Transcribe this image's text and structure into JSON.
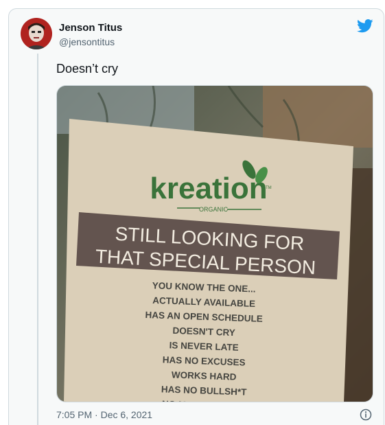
{
  "tweet": {
    "author_name": "Jenson Titus",
    "author_handle": "@jensontitus",
    "text": "Doesn’t cry",
    "timestamp": "7:05 PM · Dec 6, 2021"
  },
  "icons": {
    "logo": "twitter-bird-icon",
    "info": "info-icon"
  },
  "sign": {
    "brand": "kreation",
    "tm": "TM",
    "sub_brand": "ORGANIC",
    "headline_line1": "STILL LOOKING FOR",
    "headline_line2": "THAT SPECIAL PERSON",
    "lines": [
      "YOU KNOW THE ONE...",
      "ACTUALLY AVAILABLE",
      "HAS AN OPEN SCHEDULE",
      "DOESN'T CRY",
      "IS NEVER LATE",
      "HAS NO EXCUSES",
      "WORKS HARD",
      "HAS NO BULLSH*T",
      "NO MATTER WHAT"
    ]
  },
  "colors": {
    "accent": "#1d9bf0",
    "brand_green": "#2e6b2e"
  }
}
